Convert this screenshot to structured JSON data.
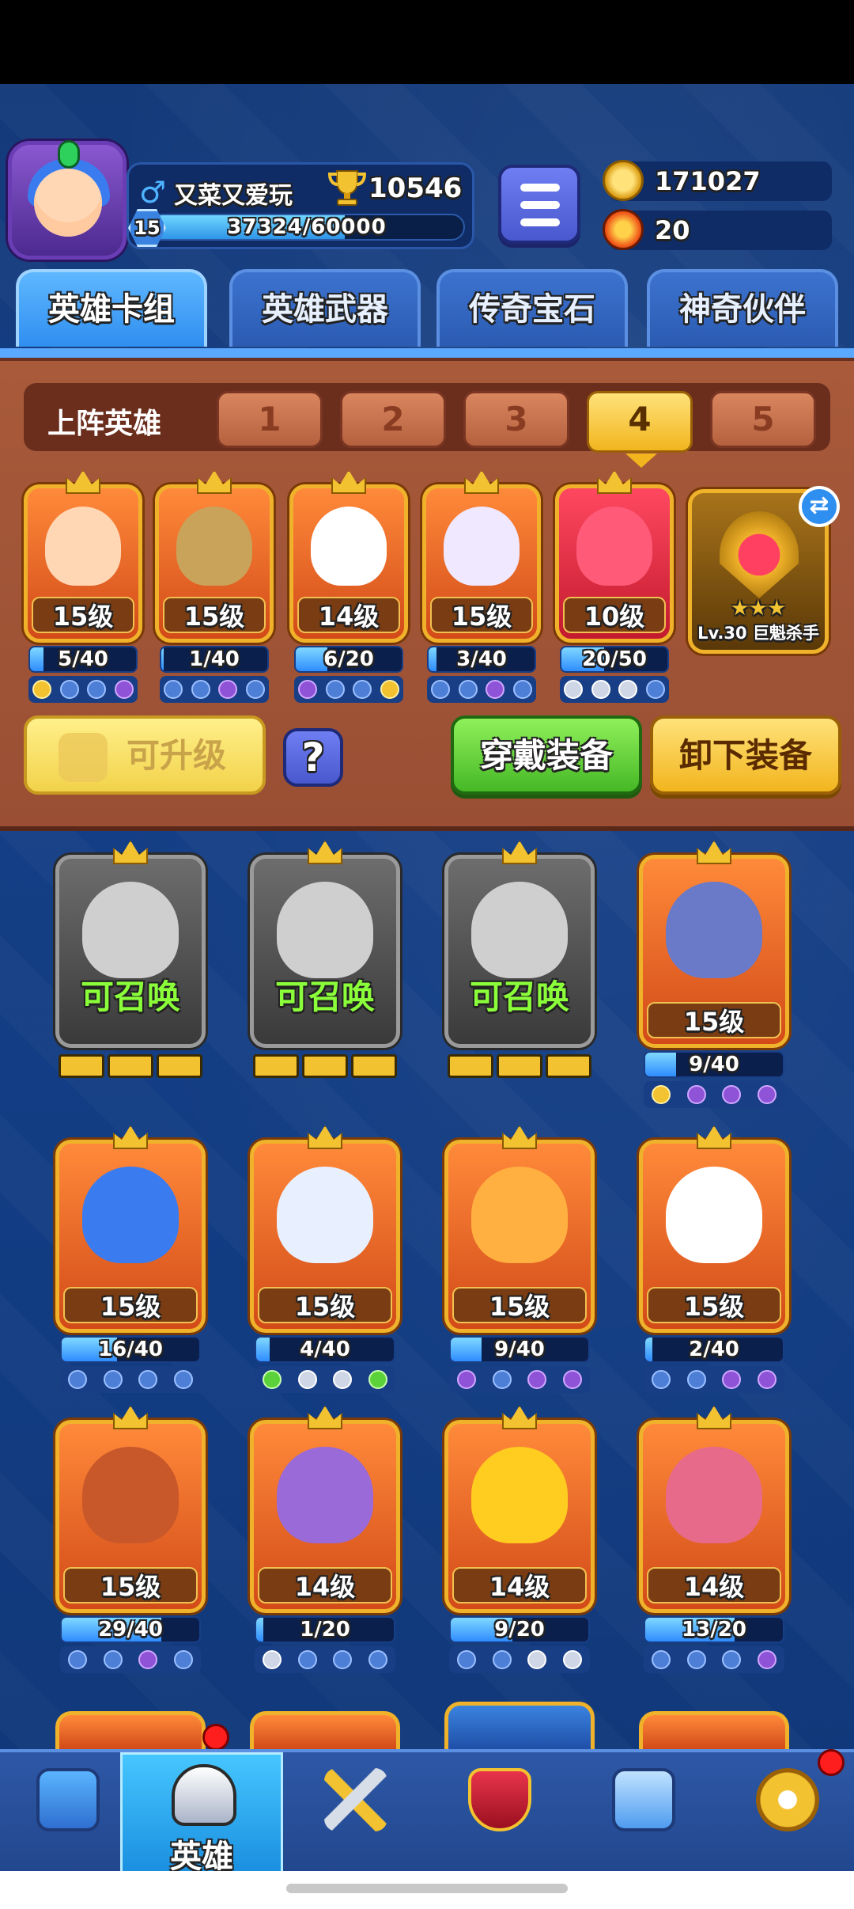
{
  "player": {
    "name": "又菜又爱玩",
    "gender_icon": "♂",
    "trophies": "10546",
    "level": "15",
    "xp_text": "37324/60000",
    "xp_fraction": 0.622
  },
  "currency": {
    "gold": "171027",
    "energy": "20"
  },
  "tabs": [
    {
      "label": "英雄卡组",
      "active": true
    },
    {
      "label": "英雄武器",
      "active": false
    },
    {
      "label": "传奇宝石",
      "active": false
    },
    {
      "label": "神奇伙伴",
      "active": false
    }
  ],
  "deck": {
    "title": "上阵英雄",
    "slots": [
      "1",
      "2",
      "3",
      "4",
      "5"
    ],
    "active_slot": "4",
    "heroes": [
      {
        "level": "15级",
        "progress": "5/40",
        "fraction": 0.125
      },
      {
        "level": "15级",
        "progress": "1/40",
        "fraction": 0.025
      },
      {
        "level": "14级",
        "progress": "6/20",
        "fraction": 0.3
      },
      {
        "level": "15级",
        "progress": "3/40",
        "fraction": 0.075
      },
      {
        "level": "10级",
        "progress": "20/50",
        "fraction": 0.4
      }
    ],
    "boss": {
      "label": "Lv.30 巨魁杀手",
      "stars": "★★★"
    },
    "swap_icon": "⇄",
    "upgrade_label": "可升级",
    "help_label": "?",
    "equip_label": "穿戴装备",
    "unequip_label": "卸下装备"
  },
  "collection": {
    "summon_label": "可召唤",
    "rows": [
      [
        {
          "type": "summon"
        },
        {
          "type": "summon"
        },
        {
          "type": "summon"
        },
        {
          "type": "hero",
          "level": "15级",
          "progress": "9/40",
          "fraction": 0.225
        }
      ],
      [
        {
          "type": "hero",
          "level": "15级",
          "progress": "16/40",
          "fraction": 0.4
        },
        {
          "type": "hero",
          "level": "15级",
          "progress": "4/40",
          "fraction": 0.1
        },
        {
          "type": "hero",
          "level": "15级",
          "progress": "9/40",
          "fraction": 0.225
        },
        {
          "type": "hero",
          "level": "15级",
          "progress": "2/40",
          "fraction": 0.05
        }
      ],
      [
        {
          "type": "hero",
          "level": "15级",
          "progress": "29/40",
          "fraction": 0.725
        },
        {
          "type": "hero",
          "level": "14级",
          "progress": "1/20",
          "fraction": 0.05
        },
        {
          "type": "hero",
          "level": "14级",
          "progress": "9/20",
          "fraction": 0.45
        },
        {
          "type": "hero",
          "level": "14级",
          "progress": "13/20",
          "fraction": 0.65
        }
      ]
    ]
  },
  "nav": [
    {
      "icon": "treasure-chest-icon",
      "label": ""
    },
    {
      "icon": "knight-helmet-icon",
      "label": "英雄",
      "active": true
    },
    {
      "icon": "crossed-swords-icon",
      "label": ""
    },
    {
      "icon": "crown-shield-icon",
      "label": ""
    },
    {
      "icon": "team-card-icon",
      "label": ""
    },
    {
      "icon": "compass-icon",
      "label": ""
    }
  ],
  "colors": {
    "gold": "#f2c230",
    "active_tab": "#2f8ff0",
    "deck_bg": "#a85a3a",
    "equip_green": "#5fd23a"
  }
}
